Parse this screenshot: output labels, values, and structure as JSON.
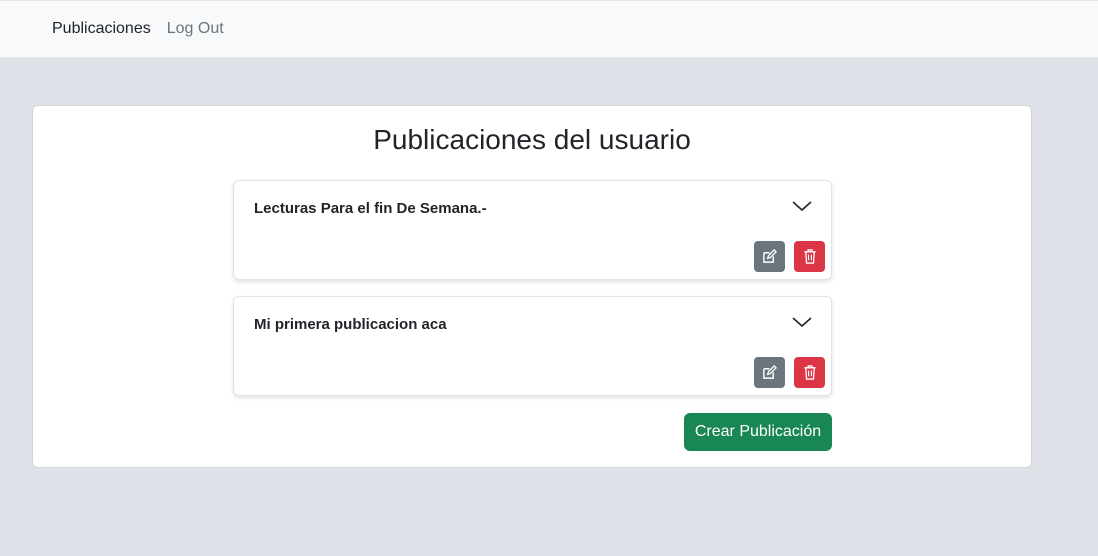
{
  "navbar": {
    "links": [
      {
        "label": "Publicaciones"
      },
      {
        "label": "Log Out"
      }
    ]
  },
  "main": {
    "title": "Publicaciones del usuario",
    "posts": [
      {
        "title": "Lecturas Para el fin De Semana.-"
      },
      {
        "title": "Mi primera publicacion aca"
      }
    ],
    "create_label": "Crear Publicación"
  },
  "colors": {
    "page_background": "#dee2e8",
    "edit_button": "#6c757d",
    "delete_button": "#dc3545",
    "create_button": "#198754"
  },
  "icons": {
    "expand": "chevron-down-icon",
    "edit": "pencil-square-icon",
    "delete": "trash-icon"
  }
}
